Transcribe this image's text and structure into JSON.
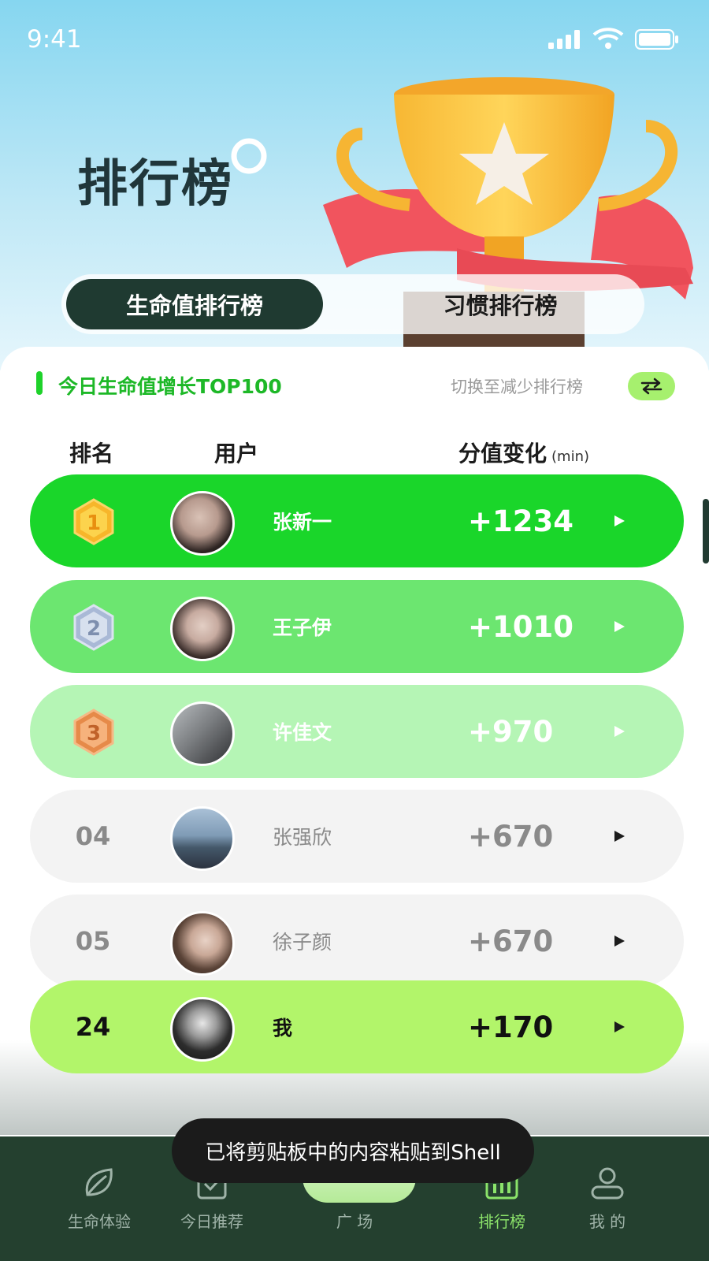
{
  "status_bar": {
    "time": "9:41"
  },
  "header": {
    "title": "排行榜"
  },
  "tabs": [
    {
      "label": "生命值排行榜",
      "active": true
    },
    {
      "label": "习惯排行榜",
      "active": false
    }
  ],
  "section": {
    "title": "今日生命值增长TOP100",
    "switch_label": "切换至减少排行榜",
    "switch_icon": "swap-arrows-icon"
  },
  "columns": {
    "rank": "排名",
    "user": "用户",
    "score": "分值变化",
    "unit": "(min)"
  },
  "rows": [
    {
      "rank": "1",
      "name": "张新一",
      "score": "+1234",
      "medal": "gold"
    },
    {
      "rank": "2",
      "name": "王子伊",
      "score": "+1010",
      "medal": "silver"
    },
    {
      "rank": "3",
      "name": "许佳文",
      "score": "+970",
      "medal": "bronze"
    },
    {
      "rank": "04",
      "name": "张强欣",
      "score": "+670"
    },
    {
      "rank": "05",
      "name": "徐子颜",
      "score": "+670"
    },
    {
      "rank": "24",
      "name": "我",
      "score": "+170",
      "is_self": true
    }
  ],
  "colors": {
    "accent_green": "#1ed22a",
    "dark_green": "#1f3a31",
    "self_row": "#b2f56a"
  },
  "toast": "已将剪贴板中的内容粘贴到Shell",
  "bottom_nav": [
    {
      "label": "生命体验",
      "icon": "leaf-icon"
    },
    {
      "label": "今日推荐",
      "icon": "checklist-icon"
    },
    {
      "label": "广 场",
      "icon": "plaza-icon"
    },
    {
      "label": "排行榜",
      "icon": "bar-chart-icon",
      "active": true
    },
    {
      "label": "我 的",
      "icon": "person-icon"
    }
  ]
}
